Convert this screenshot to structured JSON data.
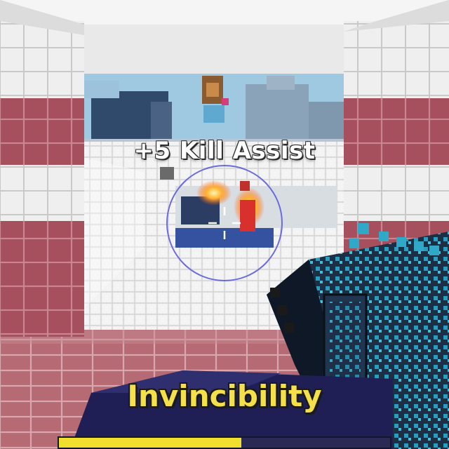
{
  "hud": {
    "kill_notification": "+5 Kill Assist",
    "ability_name": "Invincibility",
    "ability_progress": 0.55
  },
  "icons": {
    "crosshair": "crosshair-icon",
    "aim_circle": "aim-circle-icon"
  },
  "colors": {
    "sky": "#9fc9e0",
    "wall_tile_white": "#f2f2f2",
    "wall_tile_red": "#a8505e",
    "floor_tile": "#b46470",
    "ability_text": "#f4e04a",
    "ability_bar_fill": "#f1df2e",
    "ability_bar_bg": "#2a2a55",
    "aim_circle": "#6a6ae0",
    "gun_body": "#1b2a3e",
    "gun_accent": "#2fa9c7"
  }
}
